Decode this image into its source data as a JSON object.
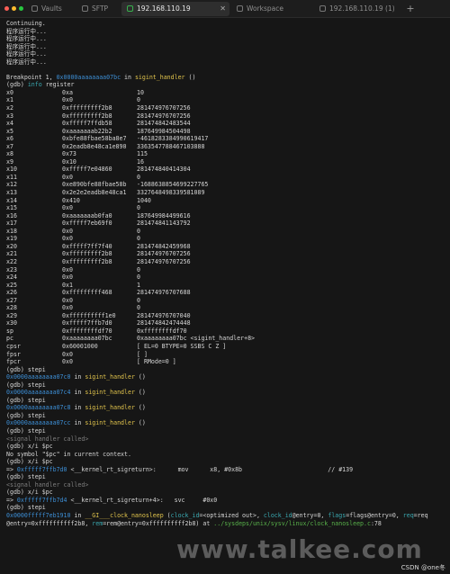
{
  "tabs": [
    {
      "label": "Vaults",
      "active": false
    },
    {
      "label": "SFTP",
      "active": false
    },
    {
      "label": "192.168.110.19",
      "active": true
    },
    {
      "label": "Workspace",
      "active": false
    },
    {
      "label": "192.168.110.19 (1)",
      "active": false
    }
  ],
  "new_tab_symbol": "+",
  "colors": {
    "address": "#3d8fd6",
    "function": "#e0c34c",
    "keyword": "#3aa8b0",
    "muted": "#7f7f7f",
    "connected": "#37b24d"
  },
  "terminal": {
    "lines": [
      [
        {
          "t": "Continuing."
        }
      ],
      [
        {
          "t": "程序运行中..."
        }
      ],
      [
        {
          "t": "程序运行中..."
        }
      ],
      [
        {
          "t": "程序运行中..."
        }
      ],
      [
        {
          "t": "程序运行中..."
        }
      ],
      [
        {
          "t": "程序运行中..."
        }
      ],
      [
        {
          "t": ""
        }
      ],
      [
        {
          "t": "Breakpoint 1, "
        },
        {
          "t": "0x0000aaaaaaaa07bc",
          "c": "addr"
        },
        {
          "t": " in "
        },
        {
          "t": "sigint_handler",
          "c": "fn"
        },
        {
          "t": " ()"
        }
      ],
      [
        {
          "t": "(gdb) "
        },
        {
          "t": "info",
          "c": "kw"
        },
        {
          "t": " register"
        }
      ],
      [
        {
          "t": "x0",
          "w": "c1"
        },
        {
          "t": "0xa",
          "w": "c2"
        },
        {
          "t": "10"
        }
      ],
      [
        {
          "t": "x1",
          "w": "c1"
        },
        {
          "t": "0x0",
          "w": "c2"
        },
        {
          "t": "0"
        }
      ],
      [
        {
          "t": "x2",
          "w": "c1"
        },
        {
          "t": "0xfffffffff2b8",
          "w": "c2"
        },
        {
          "t": "281474976707256"
        }
      ],
      [
        {
          "t": "x3",
          "w": "c1"
        },
        {
          "t": "0xfffffffff2b8",
          "w": "c2"
        },
        {
          "t": "281474976707256"
        }
      ],
      [
        {
          "t": "x4",
          "w": "c1"
        },
        {
          "t": "0xfffff7ffdb58",
          "w": "c2"
        },
        {
          "t": "281474842483544"
        }
      ],
      [
        {
          "t": "x5",
          "w": "c1"
        },
        {
          "t": "0xaaaaaaab22b2",
          "w": "c2"
        },
        {
          "t": "187649984504498"
        }
      ],
      [
        {
          "t": "x6",
          "w": "c1"
        },
        {
          "t": "0xbfe88fbae58ba8e7",
          "w": "c2"
        },
        {
          "t": "-4618283384990619417"
        }
      ],
      [
        {
          "t": "x7",
          "w": "c1"
        },
        {
          "t": "0x2eadb8e48ca1e890",
          "w": "c2"
        },
        {
          "t": "3363547788467103888"
        }
      ],
      [
        {
          "t": "x8",
          "w": "c1"
        },
        {
          "t": "0x73",
          "w": "c2"
        },
        {
          "t": "115"
        }
      ],
      [
        {
          "t": "x9",
          "w": "c1"
        },
        {
          "t": "0x10",
          "w": "c2"
        },
        {
          "t": "16"
        }
      ],
      [
        {
          "t": "x10",
          "w": "c1"
        },
        {
          "t": "0xfffff7e04860",
          "w": "c2"
        },
        {
          "t": "281474840414304"
        }
      ],
      [
        {
          "t": "x11",
          "w": "c1"
        },
        {
          "t": "0x0",
          "w": "c2"
        },
        {
          "t": "0"
        }
      ],
      [
        {
          "t": "x12",
          "w": "c1"
        },
        {
          "t": "0xe890bfe88fbae58b",
          "w": "c2"
        },
        {
          "t": "-1688638854699227765"
        }
      ],
      [
        {
          "t": "x13",
          "w": "c1"
        },
        {
          "t": "0x2e2e2eadb8e48ca1",
          "w": "c2"
        },
        {
          "t": "3327648498339581089"
        }
      ],
      [
        {
          "t": "x14",
          "w": "c1"
        },
        {
          "t": "0x410",
          "w": "c2"
        },
        {
          "t": "1040"
        }
      ],
      [
        {
          "t": "x15",
          "w": "c1"
        },
        {
          "t": "0x0",
          "w": "c2"
        },
        {
          "t": "0"
        }
      ],
      [
        {
          "t": "x16",
          "w": "c1"
        },
        {
          "t": "0xaaaaaaab0fa0",
          "w": "c2"
        },
        {
          "t": "187649984499616"
        }
      ],
      [
        {
          "t": "x17",
          "w": "c1"
        },
        {
          "t": "0xfffff7eb69f0",
          "w": "c2"
        },
        {
          "t": "281474841143792"
        }
      ],
      [
        {
          "t": "x18",
          "w": "c1"
        },
        {
          "t": "0x0",
          "w": "c2"
        },
        {
          "t": "0"
        }
      ],
      [
        {
          "t": "x19",
          "w": "c1"
        },
        {
          "t": "0x0",
          "w": "c2"
        },
        {
          "t": "0"
        }
      ],
      [
        {
          "t": "x20",
          "w": "c1"
        },
        {
          "t": "0xfffff7ff7f40",
          "w": "c2"
        },
        {
          "t": "281474842459968"
        }
      ],
      [
        {
          "t": "x21",
          "w": "c1"
        },
        {
          "t": "0xfffffffff2b8",
          "w": "c2"
        },
        {
          "t": "281474976707256"
        }
      ],
      [
        {
          "t": "x22",
          "w": "c1"
        },
        {
          "t": "0xfffffffff2b8",
          "w": "c2"
        },
        {
          "t": "281474976707256"
        }
      ],
      [
        {
          "t": "x23",
          "w": "c1"
        },
        {
          "t": "0x0",
          "w": "c2"
        },
        {
          "t": "0"
        }
      ],
      [
        {
          "t": "x24",
          "w": "c1"
        },
        {
          "t": "0x0",
          "w": "c2"
        },
        {
          "t": "0"
        }
      ],
      [
        {
          "t": "x25",
          "w": "c1"
        },
        {
          "t": "0x1",
          "w": "c2"
        },
        {
          "t": "1"
        }
      ],
      [
        {
          "t": "x26",
          "w": "c1"
        },
        {
          "t": "0xfffffffff468",
          "w": "c2"
        },
        {
          "t": "281474976707688"
        }
      ],
      [
        {
          "t": "x27",
          "w": "c1"
        },
        {
          "t": "0x0",
          "w": "c2"
        },
        {
          "t": "0"
        }
      ],
      [
        {
          "t": "x28",
          "w": "c1"
        },
        {
          "t": "0x0",
          "w": "c2"
        },
        {
          "t": "0"
        }
      ],
      [
        {
          "t": "x29",
          "w": "c1"
        },
        {
          "t": "0xffffffffff1e0",
          "w": "c2"
        },
        {
          "t": "281474976707040"
        }
      ],
      [
        {
          "t": "x30",
          "w": "c1"
        },
        {
          "t": "0xfffff7ffb7d0",
          "w": "c2"
        },
        {
          "t": "281474842474448"
        }
      ],
      [
        {
          "t": "sp",
          "w": "c1"
        },
        {
          "t": "0xffffffffdf70",
          "w": "c2"
        },
        {
          "t": "0xffffffffdf70"
        }
      ],
      [
        {
          "t": "pc",
          "w": "c1"
        },
        {
          "t": "0xaaaaaaaa07bc",
          "w": "c2"
        },
        {
          "t": "0xaaaaaaaa07bc <sigint_handler+8>"
        }
      ],
      [
        {
          "t": "cpsr",
          "w": "c1"
        },
        {
          "t": "0x60001000",
          "w": "c2"
        },
        {
          "t": "[ EL=0 BTYPE=0 SSBS C Z ]"
        }
      ],
      [
        {
          "t": "fpsr",
          "w": "c1"
        },
        {
          "t": "0x0",
          "w": "c2"
        },
        {
          "t": "[ ]"
        }
      ],
      [
        {
          "t": "fpcr",
          "w": "c1"
        },
        {
          "t": "0x0",
          "w": "c2"
        },
        {
          "t": "[ RMode=0 ]"
        }
      ],
      [
        {
          "t": "(gdb) stepi"
        }
      ],
      [
        {
          "t": "0x0000aaaaaaaa07c0",
          "c": "addr"
        },
        {
          "t": " in "
        },
        {
          "t": "sigint_handler",
          "c": "fn"
        },
        {
          "t": " ()"
        }
      ],
      [
        {
          "t": "(gdb) stepi"
        }
      ],
      [
        {
          "t": "0x0000aaaaaaaa07c4",
          "c": "addr"
        },
        {
          "t": " in "
        },
        {
          "t": "sigint_handler",
          "c": "fn"
        },
        {
          "t": " ()"
        }
      ],
      [
        {
          "t": "(gdb) stepi"
        }
      ],
      [
        {
          "t": "0x0000aaaaaaaa07c8",
          "c": "addr"
        },
        {
          "t": " in "
        },
        {
          "t": "sigint_handler",
          "c": "fn"
        },
        {
          "t": " ()"
        }
      ],
      [
        {
          "t": "(gdb) stepi"
        }
      ],
      [
        {
          "t": "0x0000aaaaaaaa07cc",
          "c": "addr"
        },
        {
          "t": " in "
        },
        {
          "t": "sigint_handler",
          "c": "fn"
        },
        {
          "t": " ()"
        }
      ],
      [
        {
          "t": "(gdb) stepi"
        }
      ],
      [
        {
          "t": "<signal handler called>",
          "c": "gr"
        }
      ],
      [
        {
          "t": "(gdb) x/i $pc"
        }
      ],
      [
        {
          "t": "No symbol \"$pc\" in current context."
        }
      ],
      [
        {
          "t": "(gdb) x/i $pc"
        }
      ],
      [
        {
          "t": "=> "
        },
        {
          "t": "0xfffff7ffb7d0",
          "c": "addr"
        },
        {
          "t": " <__kernel_rt_sigreturn>:      mov      x8, #0x8b                        // #139"
        }
      ],
      [
        {
          "t": "(gdb) stepi"
        }
      ],
      [
        {
          "t": "<signal handler called>",
          "c": "gr"
        }
      ],
      [
        {
          "t": "(gdb) x/i $pc"
        }
      ],
      [
        {
          "t": "=> "
        },
        {
          "t": "0xfffff7ffb7d4",
          "c": "addr"
        },
        {
          "t": " <__kernel_rt_sigreturn+4>:   svc     #0x0"
        }
      ],
      [
        {
          "t": "(gdb) stepi"
        }
      ],
      [
        {
          "t": "0x0000fffff7eb1910",
          "c": "addr"
        },
        {
          "t": " in "
        },
        {
          "t": "__GI___clock_nanosleep",
          "c": "fn"
        },
        {
          "t": " ("
        },
        {
          "t": "clock_id",
          "c": "kw"
        },
        {
          "t": "=<optimized out>, "
        },
        {
          "t": "clock_id",
          "c": "kw"
        },
        {
          "t": "@entry=0, "
        },
        {
          "t": "flags",
          "c": "kw"
        },
        {
          "t": "=flags@entry=0, "
        },
        {
          "t": "req",
          "c": "kw"
        },
        {
          "t": "=req"
        }
      ],
      [
        {
          "t": "@entry=0xffffffffff2b8, "
        },
        {
          "t": "rem",
          "c": "kw"
        },
        {
          "t": "=rem@entry=0xffffffffff2b8) at "
        },
        {
          "t": "../sysdeps/unix/sysv/linux/clock_nanosleep.c",
          "c": "grn"
        },
        {
          "t": ":78"
        }
      ]
    ]
  },
  "watermark": "www.talkee.com",
  "footer_credit": "CSDN @one冬"
}
